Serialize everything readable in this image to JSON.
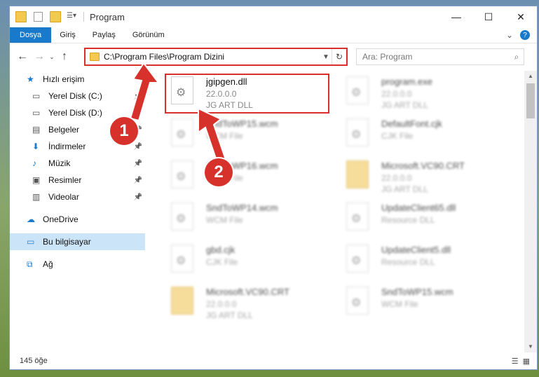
{
  "window": {
    "title": "Program"
  },
  "ribbon": {
    "tabs": [
      "Dosya",
      "Giriş",
      "Paylaş",
      "Görünüm"
    ]
  },
  "address": {
    "path": "C:\\Program Files\\Program Dizini"
  },
  "search": {
    "placeholder": "Ara: Program"
  },
  "sidebar": {
    "items": [
      {
        "label": "Hızlı erişim",
        "icon": "star-icon"
      },
      {
        "label": "Yerel Disk (C:)",
        "icon": "drive-icon",
        "pinned": true
      },
      {
        "label": "Yerel Disk (D:)",
        "icon": "drive-icon",
        "pinned": true
      },
      {
        "label": "Belgeler",
        "icon": "document-icon",
        "pinned": true
      },
      {
        "label": "İndirmeler",
        "icon": "download-icon",
        "pinned": true
      },
      {
        "label": "Müzik",
        "icon": "music-icon",
        "pinned": true
      },
      {
        "label": "Resimler",
        "icon": "pictures-icon",
        "pinned": true
      },
      {
        "label": "Videolar",
        "icon": "video-icon",
        "pinned": true
      },
      {
        "label": "OneDrive",
        "icon": "cloud-icon"
      },
      {
        "label": "Bu bilgisayar",
        "icon": "computer-icon",
        "selected": true
      },
      {
        "label": "Ağ",
        "icon": "network-icon"
      }
    ]
  },
  "files": [
    {
      "name": "jgipgen.dll",
      "line2": "22.0.0.0",
      "line3": "JG ART DLL",
      "highlight": true
    },
    {
      "name": "program.exe",
      "line2": "22.0.0.0",
      "line3": "JG ART DLL"
    },
    {
      "name": "SndToWP15.wcm",
      "line2": "WCM File",
      "line3": ""
    },
    {
      "name": "DefaultFont.cjk",
      "line2": "CJK File",
      "line3": ""
    },
    {
      "name": "SndToWP16.wcm",
      "line2": "WCM File",
      "line3": ""
    },
    {
      "name": "Microsoft.VC90.CRT",
      "line2": "22.0.0.0",
      "line3": "JG ART DLL"
    },
    {
      "name": "SndToWP14.wcm",
      "line2": "WCM File",
      "line3": ""
    },
    {
      "name": "UpdateClient65.dll",
      "line2": "Resource DLL",
      "line3": ""
    },
    {
      "name": "gbd.cjk",
      "line2": "CJK File",
      "line3": ""
    },
    {
      "name": "UpdateClient5.dll",
      "line2": "Resource DLL",
      "line3": ""
    },
    {
      "name": "Microsoft.VC90.CRT",
      "line2": "22.0.0.0",
      "line3": "JG ART DLL"
    },
    {
      "name": "SndToWP15.wcm",
      "line2": "WCM File",
      "line3": ""
    }
  ],
  "status": {
    "count": "145 öğe"
  },
  "annotations": {
    "badge1": "1",
    "badge2": "2"
  },
  "colors": {
    "accent": "#1979ca",
    "annotation": "#d6312b",
    "selection": "#cce4f7"
  }
}
